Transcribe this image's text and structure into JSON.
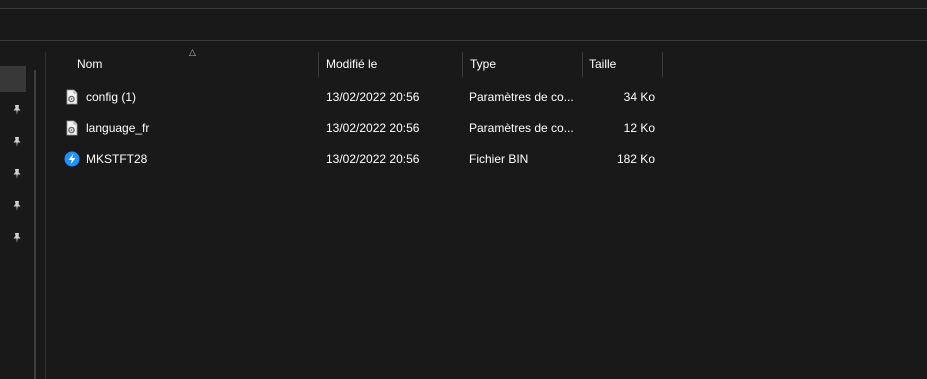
{
  "columns": {
    "name": "Nom",
    "modified": "Modifié le",
    "type": "Type",
    "size": "Taille"
  },
  "files": [
    {
      "name": "config (1)",
      "modified": "13/02/2022 20:56",
      "type": "Paramètres de co...",
      "size": "34 Ko",
      "icon": "settings-file-icon"
    },
    {
      "name": "language_fr",
      "modified": "13/02/2022 20:56",
      "type": "Paramètres de co...",
      "size": "12 Ko",
      "icon": "settings-file-icon"
    },
    {
      "name": "MKSTFT28",
      "modified": "13/02/2022 20:56",
      "type": "Fichier BIN",
      "size": "182 Ko",
      "icon": "bin-file-icon"
    }
  ],
  "quick_access_pins": [
    "pin-icon",
    "pin-icon",
    "pin-icon",
    "pin-icon",
    "pin-icon"
  ],
  "colors": {
    "background": "#191919",
    "text": "#ffffff",
    "separator": "#3c3c3c",
    "bin_icon": "#1e90ff"
  }
}
